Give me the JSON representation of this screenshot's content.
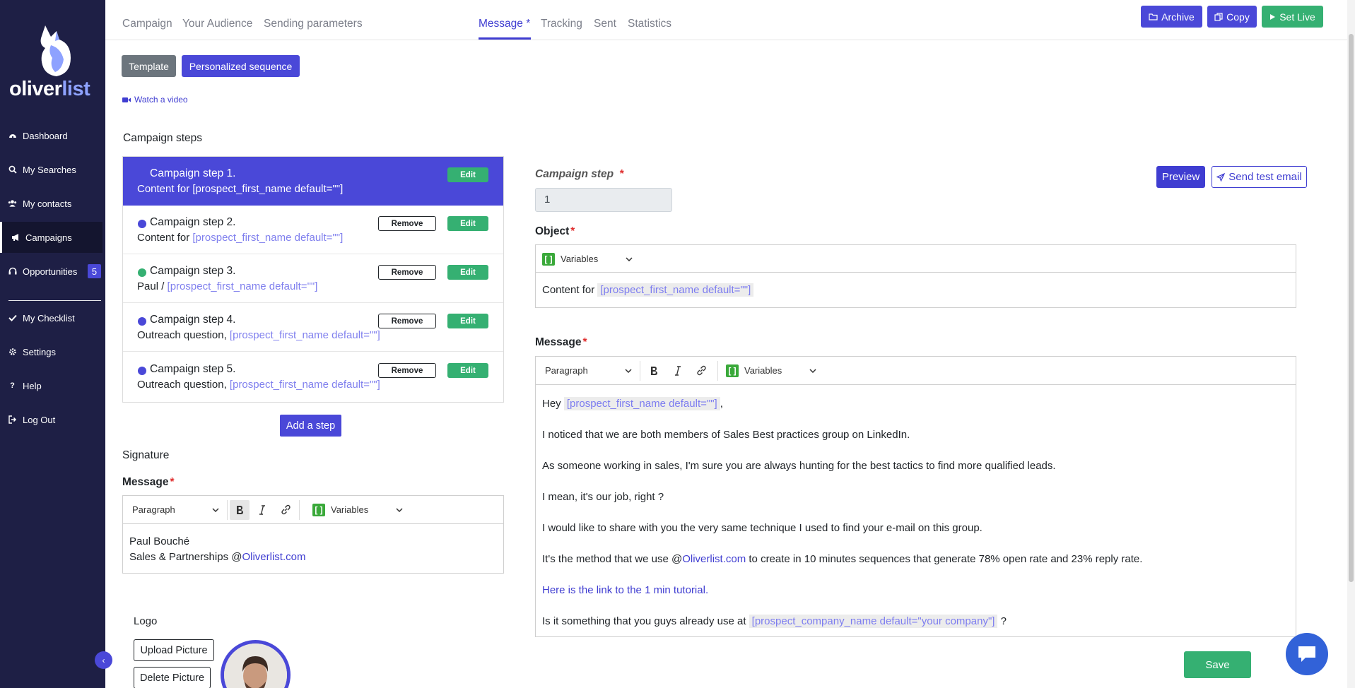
{
  "sidebar": {
    "logo_part1": "oliver",
    "logo_part2": "list",
    "items": [
      {
        "label": "Dashboard",
        "icon": "dashboard-icon"
      },
      {
        "label": "My Searches",
        "icon": "search-icon"
      },
      {
        "label": "My contacts",
        "icon": "users-icon"
      },
      {
        "label": "Campaigns",
        "icon": "megaphone-icon"
      },
      {
        "label": "Opportunities",
        "icon": "headset-icon",
        "badge": "5"
      },
      {
        "label": "My Checklist",
        "icon": "check-icon"
      },
      {
        "label": "Settings",
        "icon": "gear-icon"
      },
      {
        "label": "Help",
        "icon": "question-icon"
      },
      {
        "label": "Log Out",
        "icon": "logout-icon"
      }
    ],
    "collapse": "‹"
  },
  "tabs": [
    "Campaign",
    "Your Audience",
    "Sending parameters",
    "Message *",
    "Tracking",
    "Sent",
    "Statistics"
  ],
  "top_actions": {
    "archive": "Archive",
    "copy": "Copy",
    "set_live": "Set Live"
  },
  "mode": {
    "template": "Template",
    "personalized": "Personalized sequence"
  },
  "watch_video": "Watch a video",
  "campaign_steps_title": "Campaign steps",
  "steps": [
    {
      "title": "Campaign step 1.",
      "prefix": "Content for ",
      "var": "[prospect_first_name default=\"\"]",
      "remove": "",
      "edit": "Edit"
    },
    {
      "title": "Campaign step 2.",
      "prefix": "Content for ",
      "var": "[prospect_first_name default=\"\"]",
      "remove": "Remove",
      "edit": "Edit"
    },
    {
      "title": "Campaign step 3.",
      "prefix": "Paul / ",
      "var": "[prospect_first_name default=\"\"]",
      "remove": "Remove",
      "edit": "Edit"
    },
    {
      "title": "Campaign step 4.",
      "prefix": "Outreach question, ",
      "var": "[prospect_first_name default=\"\"]",
      "remove": "Remove",
      "edit": "Edit"
    },
    {
      "title": "Campaign step 5.",
      "prefix": "Outreach question, ",
      "var": "[prospect_first_name default=\"\"]",
      "remove": "Remove",
      "edit": "Edit"
    }
  ],
  "colors": {
    "accent": "#4a48d8",
    "green": "#35b072",
    "step_dot_blue": "#4a48d8",
    "step_dot_green": "#35b072"
  },
  "add_step": "Add a step",
  "signature": {
    "title": "Signature",
    "message_label": "Message",
    "required_mark": "*",
    "toolbar": {
      "paragraph": "Paragraph",
      "variables": "Variables"
    },
    "line1": "Paul Bouché",
    "line2_prefix": "Sales & Partnerships @",
    "line2_link": "Oliverlist.com"
  },
  "logo_section": {
    "title": "Logo",
    "upload": "Upload Picture",
    "delete": "Delete Picture"
  },
  "right": {
    "step_label": "Campaign step",
    "step_value": "1",
    "preview": "Preview",
    "send_test": "Send test email",
    "object_label": "Object",
    "object_toolbar_variables": "Variables",
    "object_prefix": "Content for ",
    "object_var": "[prospect_first_name default=\"\"]",
    "message_label": "Message",
    "toolbar": {
      "paragraph": "Paragraph",
      "variables": "Variables"
    },
    "body": {
      "l1_prefix": "Hey ",
      "l1_var": "[prospect_first_name default=\"\"]",
      "l1_suffix": ",",
      "l2": "I noticed that we are both members of Sales Best practices group on LinkedIn.",
      "l3": "As someone working in sales, I'm sure you are always hunting for the best tactics to find more qualified leads.",
      "l4": "I mean, it's our job, right ?",
      "l5": "I would like to share with you the very same technique I used to find your e-mail on this group.",
      "l6_prefix": "It's the method that we use @",
      "l6_link": "Oliverlist.com",
      "l6_suffix": " to create in 10 minutes sequences that generate 78% open rate and 23% reply rate.",
      "l7": "Here is the link to the 1 min tutorial.",
      "l8_prefix": "Is it something that you guys already use at ",
      "l8_var": "[prospect_company_name default=\"your company\"]",
      "l8_suffix": "  ?"
    },
    "save": "Save"
  }
}
